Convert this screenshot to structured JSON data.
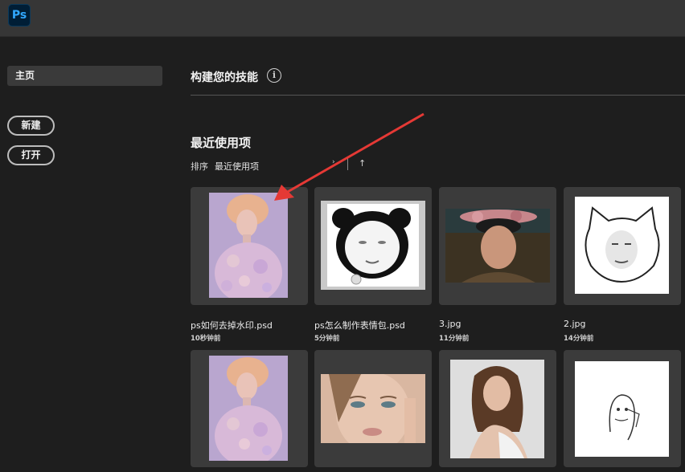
{
  "app": {
    "logo_text": "Ps"
  },
  "sidebar": {
    "home_label": "主页",
    "new_label": "新建",
    "open_label": "打开"
  },
  "learn": {
    "title": "构建您的技能",
    "info_glyph": "i"
  },
  "recent": {
    "title": "最近使用项",
    "sort_label": "排序",
    "sort_value": "最近使用项",
    "sort_direction_glyph": "↑",
    "chevron_glyph": "›",
    "files": [
      {
        "name": "ps如何去掉水印.psd",
        "time": "10秒钟前",
        "thumb": "portrait-pastel-icon"
      },
      {
        "name": "ps怎么制作表情包.psd",
        "time": "5分钟前",
        "thumb": "panda-meme-icon"
      },
      {
        "name": "3.jpg",
        "time": "11分钟前",
        "thumb": "woman-headdress-icon"
      },
      {
        "name": "2.jpg",
        "time": "14分钟前",
        "thumb": "cat-meme-icon"
      },
      {
        "thumb": "portrait-pastel-icon"
      },
      {
        "thumb": "face-closeup-icon"
      },
      {
        "thumb": "woman-portrait-icon"
      },
      {
        "thumb": "sketch-meme-icon"
      }
    ]
  },
  "colors": {
    "annotation_arrow": "#e53935",
    "ps_blue": "#31a8ff"
  }
}
